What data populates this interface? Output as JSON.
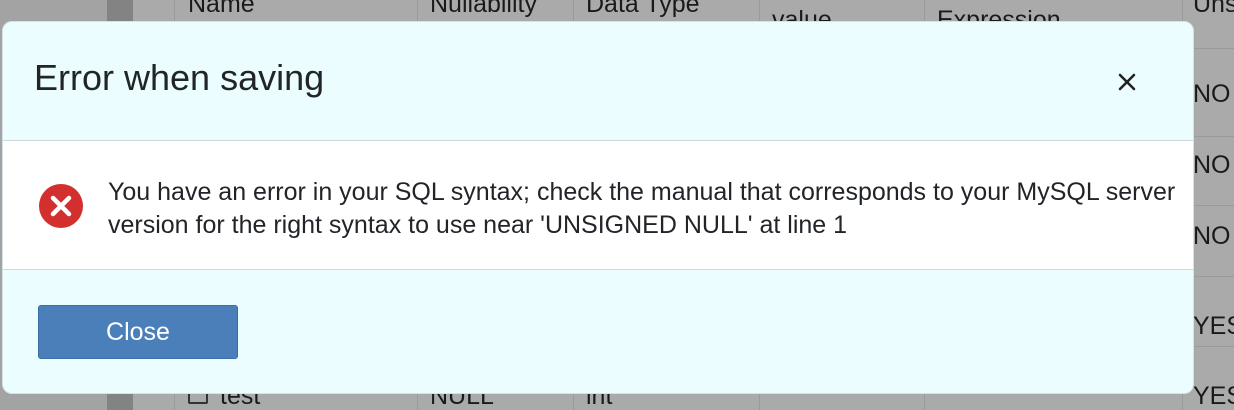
{
  "background_table": {
    "headers": [
      "Name",
      "Nullability",
      "Data Type",
      "value",
      "Expression",
      "Uns"
    ],
    "right_column_values": [
      "NO",
      "NO",
      "NO",
      "YES",
      "YES"
    ],
    "partial_row": {
      "name": "test",
      "nullability": "NULL",
      "data_type": "int"
    }
  },
  "dialog": {
    "title": "Error when saving",
    "close_icon": "close-icon",
    "error_icon": "error-circle-icon",
    "message": "You have an error in your SQL syntax; check the manual that corresponds to your MySQL server version for the right syntax to use near 'UNSIGNED NULL' at line 1",
    "close_button_label": "Close"
  },
  "colors": {
    "modal_background": "#ecfdff",
    "body_background": "#ffffff",
    "error_icon": "#d32f2f",
    "primary_button": "#4a7fba"
  }
}
